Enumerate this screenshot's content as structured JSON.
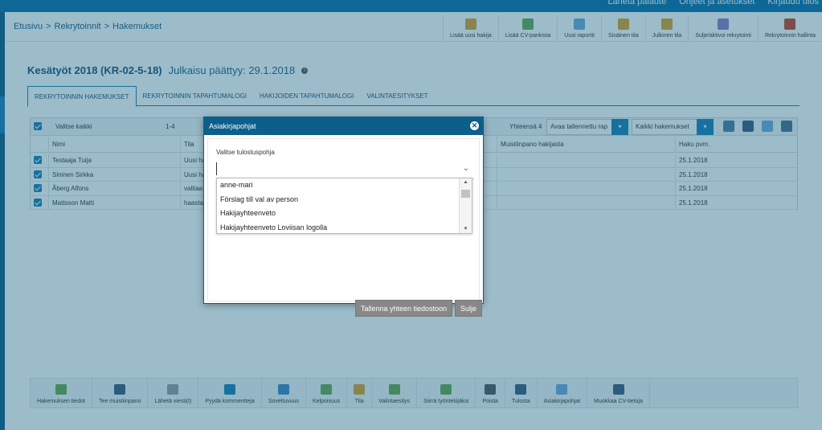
{
  "topbar": {
    "links": [
      "Lähetä palaute",
      "Ohjeet ja asetukset",
      "Kirjaudu ulos"
    ]
  },
  "breadcrumb": [
    "Etusivu",
    ">",
    "Rekrytoinnit",
    ">",
    "Hakemukset"
  ],
  "toolbar": [
    {
      "label": "Lisää uusi hakija",
      "color": "#e0a12a"
    },
    {
      "label": "Lisää CV-pankista",
      "color": "#6aa84f"
    },
    {
      "label": "Uusi raportti",
      "color": "#6fa8dc"
    },
    {
      "label": "Sisäinen tila",
      "color": "#e0a12a"
    },
    {
      "label": "Julkinen tila",
      "color": "#e0a12a"
    },
    {
      "label": "Sulje/aktivoi rekrytointi",
      "color": "#8e7cc3"
    },
    {
      "label": "Rekrytoinnin hallinta",
      "color": "#cc4125"
    }
  ],
  "page": {
    "title": "Kesätyöt 2018 (KR-02-5-18)",
    "subtitle": "Julkaisu päättyy: 29.1.2018",
    "info_icon": "i"
  },
  "tabs": [
    "REKRYTOINNIN HAKEMUKSET",
    "REKRYTOINNIN TAPAHTUMALOGI",
    "HAKIJOIDEN TAPAHTUMALOGI",
    "VALINTAESITYKSET"
  ],
  "grid": {
    "select_all": "Valitse kaikki",
    "range": "1-4",
    "total": "Yhteensä 4",
    "saved_report": "Avaa tallennettu rap",
    "filter": "Kaikki hakemukset",
    "columns": [
      "Nimi",
      "Tila",
      "Muistiinpano hakijasta",
      "Haku pvm."
    ],
    "rows": [
      {
        "name": "Testaaja Tuija",
        "status": "Uusi ha",
        "date": "25.1.2018"
      },
      {
        "name": "Sininen Sirkka",
        "status": "Uusi ha",
        "date": "25.1.2018"
      },
      {
        "name": "Åberg Alfons",
        "status": "valitaa",
        "date": "25.1.2018"
      },
      {
        "name": "Mattsson Matti",
        "status": "haasta",
        "date": "25.1.2018"
      }
    ]
  },
  "bottom_toolbar": [
    {
      "label": "Hakemuksen tiedot",
      "color": "#6aa84f"
    },
    {
      "label": "Tee muistiinpano",
      "color": "#3d5a80"
    },
    {
      "label": "Lähetä viesti(t)",
      "color": "#999999"
    },
    {
      "label": "Pyydä kommentteja",
      "color": "#1a7fb5"
    },
    {
      "label": "Soveltuvuus",
      "color": "#3d85c6"
    },
    {
      "label": "Kelpoisuus",
      "color": "#6aa84f"
    },
    {
      "label": "Tila",
      "color": "#e0a12a"
    },
    {
      "label": "Valintaesitys",
      "color": "#6aa84f"
    },
    {
      "label": "Siirrä työntekijäksi",
      "color": "#6aa84f"
    },
    {
      "label": "Poista",
      "color": "#555555"
    },
    {
      "label": "Tulosta",
      "color": "#3d5a80"
    },
    {
      "label": "Asiakirjapohjat",
      "color": "#6fa8dc"
    },
    {
      "label": "Muokkaa CV-tietoja",
      "color": "#3d5a80"
    }
  ],
  "modal": {
    "title": "Asiakirjapohjat",
    "close_glyph": "✕",
    "field_label": "Valitse tulostuspohja",
    "options": [
      "anne-mari",
      "Förslag till val av person",
      "Hakijayhteenveto",
      "Hakijayhteenveto Loviisan logolla"
    ],
    "save_button": "Tallenna yhteen tiedostoon",
    "close_button": "Sulje"
  }
}
